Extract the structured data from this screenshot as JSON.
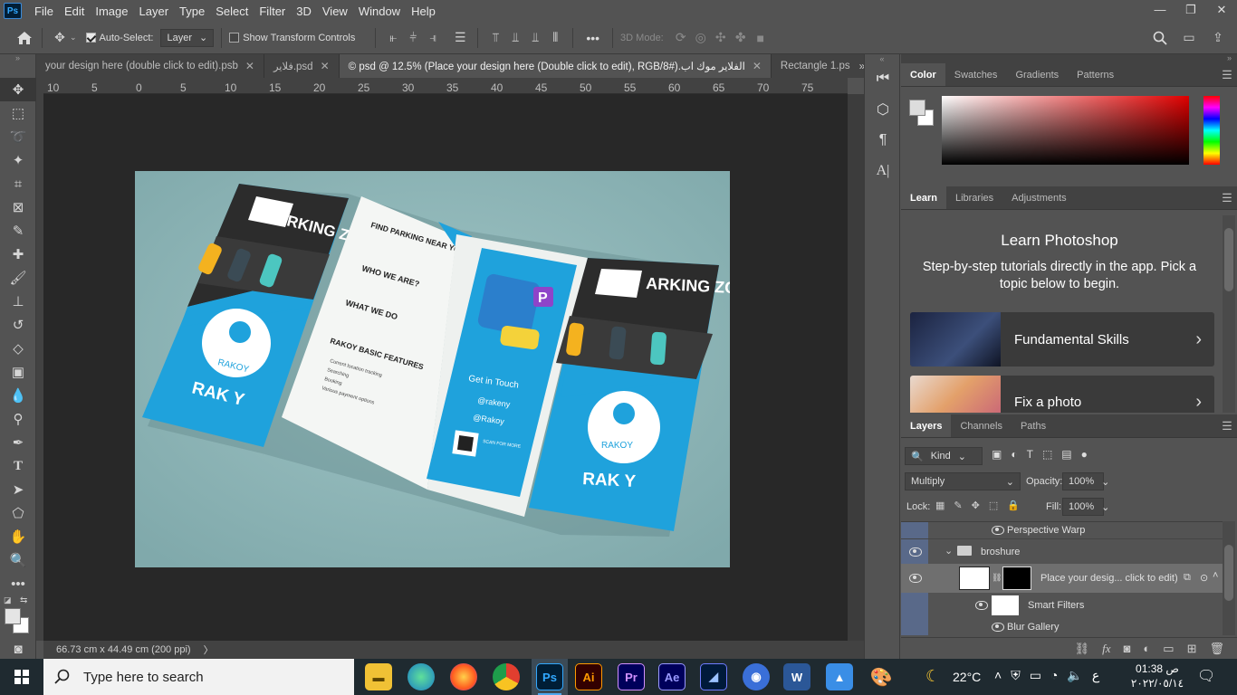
{
  "menu": {
    "items": [
      "File",
      "Edit",
      "Image",
      "Layer",
      "Type",
      "Select",
      "Filter",
      "3D",
      "View",
      "Window",
      "Help"
    ],
    "logo": "Ps"
  },
  "window_controls": {
    "minimize": "—",
    "restore": "❐",
    "close": "✕"
  },
  "options": {
    "auto_select_label": "Auto-Select:",
    "auto_select_checked": true,
    "target": "Layer",
    "transform_label": "Show Transform Controls",
    "transform_checked": false,
    "mode3d": "3D Mode:",
    "more": "•••"
  },
  "tabs": [
    {
      "label": "your design here (double click to edit).psb",
      "active": false
    },
    {
      "label": "فلاير.psd",
      "active": false
    },
    {
      "label": "الفلاير موك اب.psd @ 12.5% (Place your design here (Double click to edit), RGB/8#) ©",
      "active": true
    },
    {
      "label": "Rectangle 1.ps",
      "active": false
    }
  ],
  "ruler": {
    "ticks": [
      "10",
      "5",
      "0",
      "5",
      "10",
      "15",
      "20",
      "25",
      "30",
      "35",
      "40",
      "45",
      "50",
      "55",
      "60",
      "65",
      "70",
      "75"
    ]
  },
  "status": {
    "doc_size": "66.73 cm x 44.49 cm (200 ppi)",
    "chevron": "〉"
  },
  "design": {
    "zone_text": "ARKING ZONE",
    "brand": "RAK Y",
    "brand_small": "RAKOY",
    "find_title": "FIND PARKING NEAR YOU",
    "find_body": "We have designed Rakoy app which will help you to find the nearby parking reserve parking lot and pay it easily and quickly.",
    "who_title": "WHO WE ARE?",
    "who_body": "Rakoy is an application that provides a wide range of car services.",
    "what_title": "WHAT WE DO",
    "what_body": "We help our clients to find the nearby parking reserve parking lot and pay for it.",
    "features_title": "RAKOY BASIC FEATURES",
    "features": [
      "Current location tracking",
      "Searching",
      "Booking",
      "Various payment options"
    ],
    "get_in_touch": "Get in Touch",
    "instagram": "@rakeny",
    "facebook": "@Rakoy",
    "scan": "SCAN FOR MORE"
  },
  "color_panel": {
    "tabs": [
      "Color",
      "Swatches",
      "Gradients",
      "Patterns"
    ]
  },
  "learn_panel": {
    "tabs": [
      "Learn",
      "Libraries",
      "Adjustments"
    ],
    "title": "Learn Photoshop",
    "subtitle": "Step-by-step tutorials directly in the app. Pick a topic below to begin.",
    "cards": [
      {
        "label": "Fundamental Skills"
      },
      {
        "label": "Fix a photo"
      }
    ]
  },
  "layers_panel": {
    "tabs": [
      "Layers",
      "Channels",
      "Paths"
    ],
    "filter_kind": "Kind",
    "blend_mode": "Multiply",
    "opacity_label": "Opacity:",
    "opacity": "100%",
    "lock_label": "Lock:",
    "fill_label": "Fill:",
    "fill": "100%",
    "rows": [
      {
        "name": "Perspective Warp"
      },
      {
        "name": "broshure"
      },
      {
        "name": "Place your desig... click to edit)"
      },
      {
        "name": "Smart Filters"
      },
      {
        "name": "Blur Gallery"
      }
    ]
  },
  "taskbar": {
    "search_placeholder": "Type here to search",
    "apps": [
      "Ai",
      "Pr",
      "Ae",
      "Ps"
    ],
    "temperature": "22°C",
    "time": "01:38 ص",
    "date": "٢٠٢٢/٠٥/١٤",
    "lang": "ع"
  },
  "colors": {
    "bg": "#535353",
    "canvas": "#282828",
    "cyan": "#21a3dc",
    "mint": "#90b6b8",
    "dark": "#2b2b2b"
  }
}
